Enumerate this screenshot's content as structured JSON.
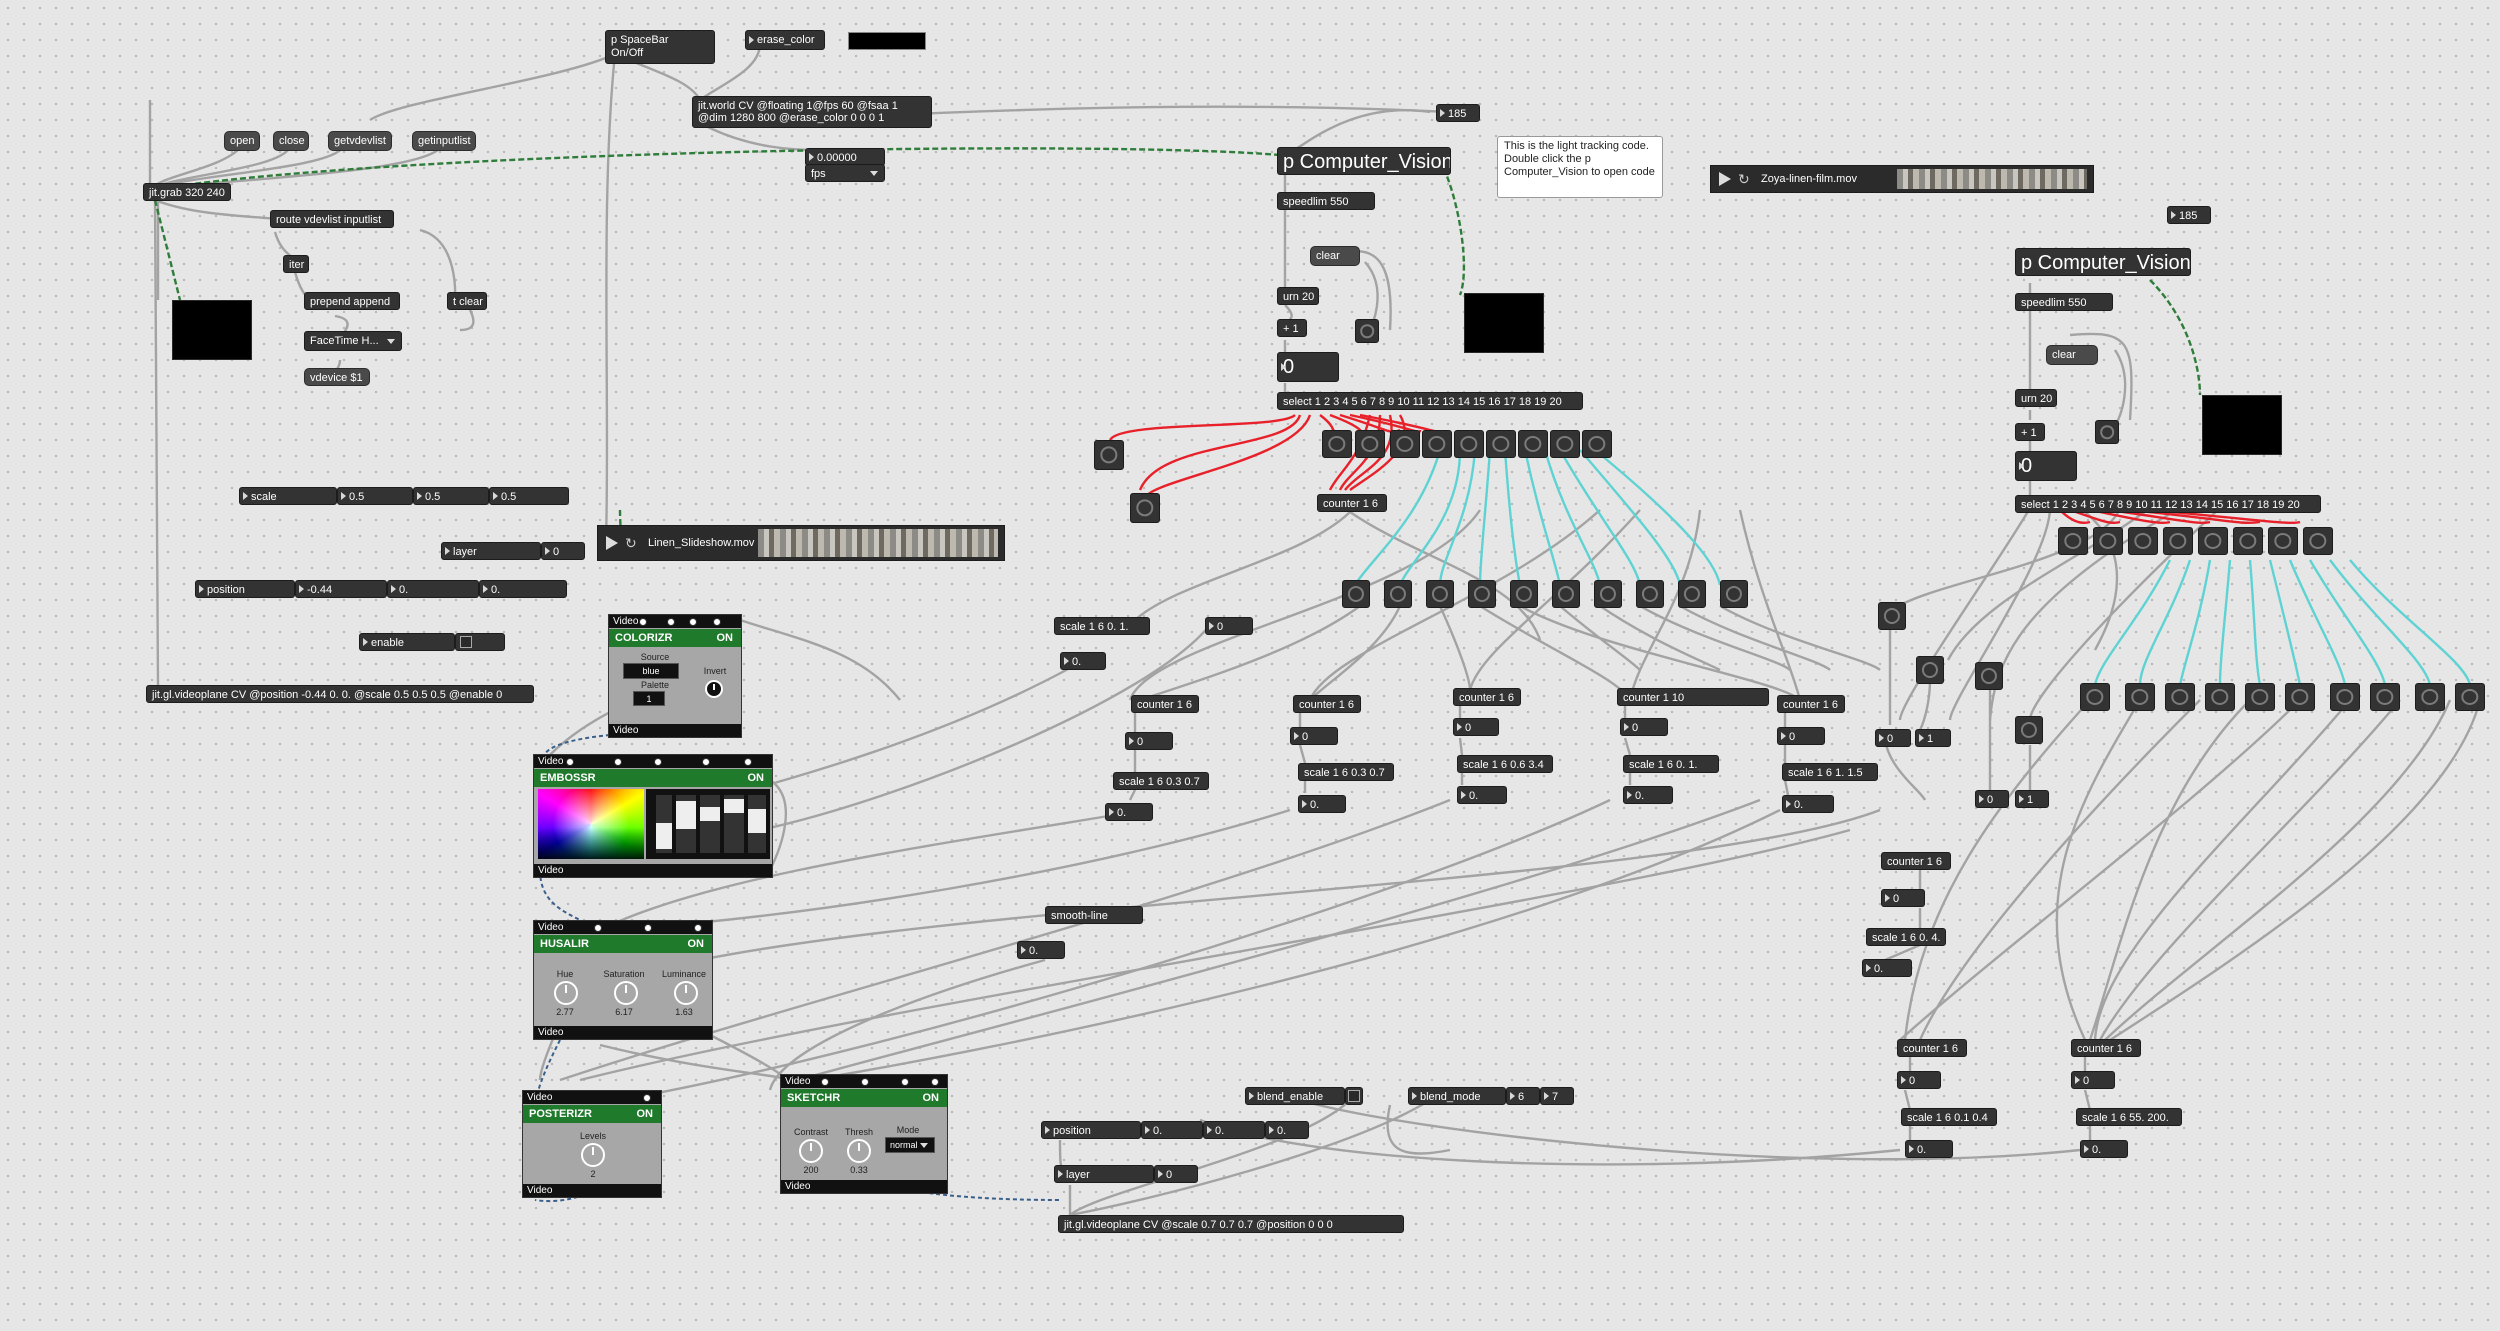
{
  "top": {
    "spacebar": "p SpaceBar\nOn/Off",
    "erase_color": "erase_color",
    "jit_world": "jit.world CV @floating 1@fps 60 @fsaa 1\n@dim 1280 800 @erase_color 0 0 0 1",
    "fps_value": "0.00000",
    "fps_menu": "fps",
    "comment": "This is the light tracking code. Double click the p Computer_Vision to open code"
  },
  "grab": {
    "open": "open",
    "close": "close",
    "getvdevlist": "getvdevlist",
    "getinputlist": "getinputlist",
    "jit_grab": "jit.grab 320 240",
    "route": "route vdevlist inputlist",
    "iter": "iter",
    "prepend": "prepend append",
    "tclear": "t clear",
    "facetime": "FaceTime H...",
    "vdevice": "vdevice $1"
  },
  "videoplane_controls": {
    "scale_label": "scale",
    "scale_values": [
      "0.5",
      "0.5",
      "0.5"
    ],
    "layer_label": "layer",
    "layer_value": "0",
    "position_label": "position",
    "position_values": [
      "-0.44",
      "0.",
      "0."
    ],
    "enable_label": "enable",
    "videoplane": "jit.gl.videoplane CV @position -0.44 0. 0. @scale 0.5 0.5 0.5 @enable 0"
  },
  "player1": {
    "file": "Linen_Slideshow.mov"
  },
  "player2": {
    "file": "Zoya-linen-film.mov"
  },
  "cv1": {
    "num185": "185",
    "title": "p Computer_Vision",
    "speedlim": "speedlim 550",
    "clear": "clear",
    "urn": "urn 20",
    "plus1": "+ 1",
    "bignum": "0",
    "select": "select 1 2 3 4 5 6 7 8 9 10 11 12 13 14 15 16 17 18 19 20",
    "counter": "counter 1 6"
  },
  "cv2": {
    "num185": "185",
    "title": "p Computer_Vision",
    "speedlim": "speedlim 550",
    "clear": "clear",
    "urn": "urn 20",
    "plus1": "+ 1",
    "bignum": "0",
    "select": "select 1 2 3 4 5 6 7 8 9 10 11 12 13 14 15 16 17 18 19 20"
  },
  "mid": {
    "scale_a": "scale 1 6 0. 1.",
    "flo_a": "0.",
    "num_a": "0",
    "counter_a": "counter 1 6",
    "num_ca": "0",
    "scale_ca": "scale 1 6 0.3 0.7",
    "flo_ca": "0.",
    "counter_b": "counter 1 6",
    "num_cb": "0",
    "scale_cb": "scale 1 6 0.3 0.7",
    "flo_cb": "0.",
    "counter_c": "counter 1 6",
    "num_cc": "0",
    "scale_cc": "scale 1 6 0.6 3.4",
    "flo_cc": "0.",
    "counter_d": "counter 1 10",
    "num_cd": "0",
    "scale_cd": "scale 1 6 0. 1.",
    "flo_cd": "0.",
    "counter_e": "counter 1 6",
    "num_ce": "0",
    "scale_ce": "scale 1 6 1. 1.5",
    "flo_ce": "0.",
    "smooth": "smooth-line",
    "flo_smooth": "0."
  },
  "right": {
    "num_l": "0",
    "num_r": "1",
    "num_c2a": "0",
    "num_c2b": "1",
    "counter_f": "counter 1 6",
    "num_cf": "0",
    "scale_cf": "scale 1 6 0. 4.",
    "flo_cf": "0.",
    "counter_g": "counter 1 6",
    "num_cg": "0",
    "scale_cg": "scale 1 6 0.1 0.4",
    "flo_cg": "0.",
    "counter_h": "counter 1 6",
    "num_ch": "0",
    "scale_ch": "scale 1 6 55. 200.",
    "flo_ch": "0."
  },
  "bottom": {
    "blend_enable": "blend_enable",
    "blend_mode": "blend_mode",
    "bm_a": "6",
    "bm_b": "7",
    "position_label": "position",
    "position_values": [
      "0.",
      "0.",
      "0."
    ],
    "layer_label": "layer",
    "layer_value": "0",
    "videoplane2": "jit.gl.videoplane CV @scale 0.7 0.7 0.7 @position 0 0 0"
  },
  "vizzie": {
    "video": "Video",
    "on": "ON",
    "colorizr": {
      "title": "COLORIZR",
      "source": "Source",
      "source_val": "blue",
      "palette": "Palette",
      "palette_val": "1",
      "invert": "Invert"
    },
    "embossr": {
      "title": "EMBOSSR"
    },
    "husalir": {
      "title": "HUSALIR",
      "hue": "Hue",
      "hue_val": "2.77",
      "saturation": "Saturation",
      "sat_val": "6.17",
      "luminance": "Luminance",
      "lum_val": "1.63"
    },
    "posterizr": {
      "title": "POSTERIZR",
      "levels": "Levels",
      "levels_val": "2"
    },
    "sketchr": {
      "title": "SKETCHR",
      "contrast": "Contrast",
      "contrast_val": "200",
      "thresh": "Thresh",
      "thresh_val": "0.33",
      "mode": "Mode",
      "mode_val": "normal"
    }
  },
  "colors": {
    "patchcord": "#a3a3a3",
    "signal_cord": "#2f7d3a",
    "red_cord": "#e8202a",
    "cyan_cord": "#5fd3d3",
    "vizzie_on": "#1f7a2b"
  }
}
